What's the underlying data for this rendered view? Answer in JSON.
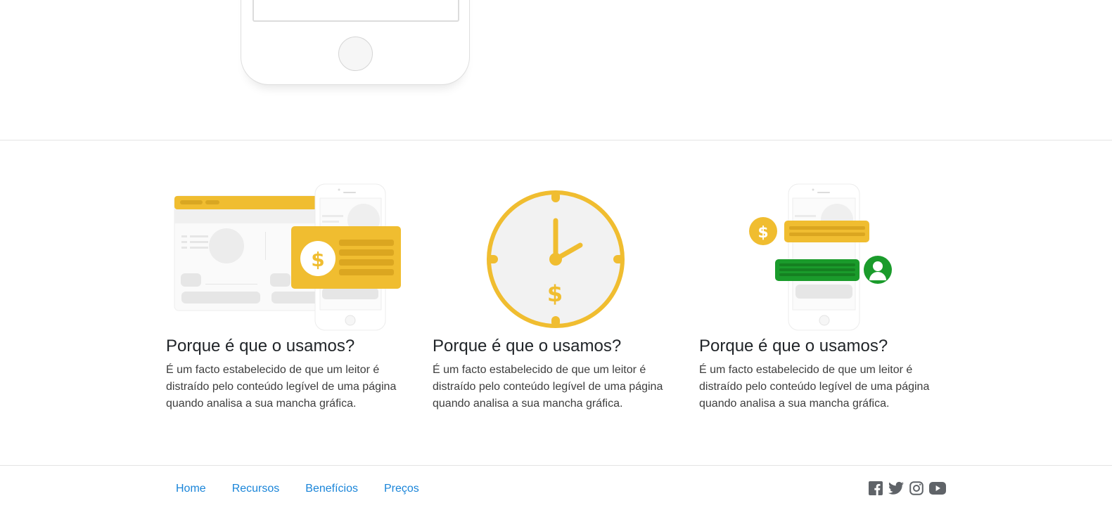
{
  "features": [
    {
      "illustration": "payment-card-on-devices",
      "title": "Porque é que o usamos?",
      "text": "É um facto estabelecido de que um leitor é distraído pelo conteúdo legível de uma página quando analisa a sua mancha gráfica."
    },
    {
      "illustration": "clock-with-dollar",
      "title": "Porque é que o usamos?",
      "text": "É um facto estabelecido de que um leitor é distraído pelo conteúdo legível de uma página quando analisa a sua mancha gráfica."
    },
    {
      "illustration": "phone-chat-payment",
      "title": "Porque é que o usamos?",
      "text": "É um facto estabelecido de que um leitor é distraído pelo conteúdo legível de uma página quando analisa a sua mancha gráfica."
    }
  ],
  "footer": {
    "nav": [
      {
        "label": "Home"
      },
      {
        "label": "Recursos"
      },
      {
        "label": "Benefícios"
      },
      {
        "label": "Preços"
      }
    ],
    "social": [
      "facebook-icon",
      "twitter-icon",
      "instagram-icon",
      "youtube-icon"
    ]
  },
  "colors": {
    "accent_yellow": "#F0BD30",
    "accent_green": "#1A9B2B",
    "link_blue": "#1A85D9",
    "icon_gray": "#5F6368"
  }
}
